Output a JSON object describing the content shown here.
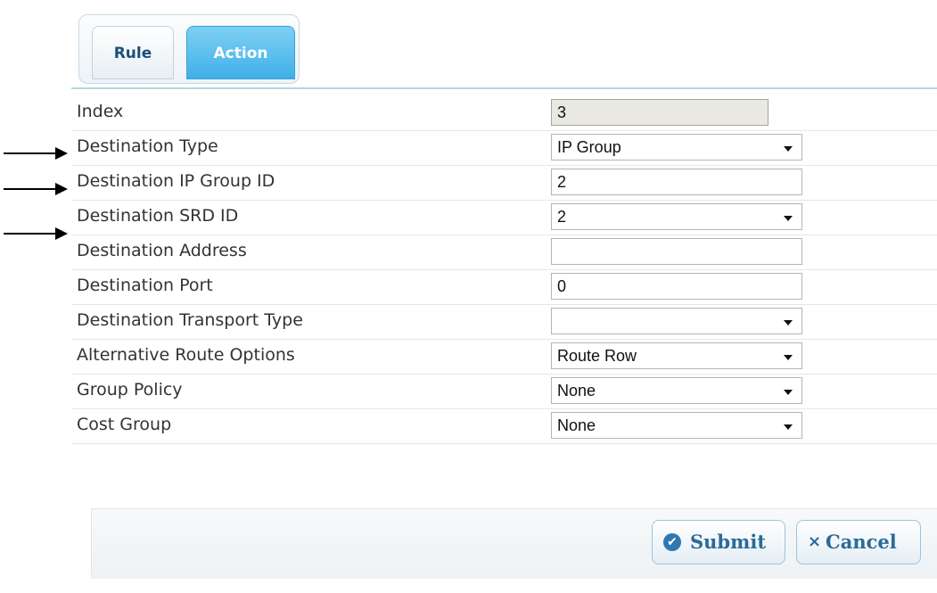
{
  "tabs": [
    {
      "label": "Rule"
    },
    {
      "label": "Action"
    }
  ],
  "form": {
    "fields": [
      {
        "label": "Index",
        "value": "3",
        "kind": "readonly"
      },
      {
        "label": "Destination Type",
        "value": "IP Group",
        "kind": "select"
      },
      {
        "label": "Destination IP Group ID",
        "value": "2",
        "kind": "text"
      },
      {
        "label": "Destination SRD ID",
        "value": "2",
        "kind": "select"
      },
      {
        "label": "Destination Address",
        "value": "",
        "kind": "text"
      },
      {
        "label": "Destination Port",
        "value": "0",
        "kind": "text"
      },
      {
        "label": "Destination Transport Type",
        "value": "",
        "kind": "select"
      },
      {
        "label": "Alternative Route Options",
        "value": "Route Row",
        "kind": "select"
      },
      {
        "label": "Group Policy",
        "value": "None",
        "kind": "select"
      },
      {
        "label": "Cost Group",
        "value": "None",
        "kind": "select"
      }
    ]
  },
  "buttons": {
    "submit_label": "Submit",
    "cancel_label": "Cancel"
  },
  "icons": {
    "submit": "check-circle-icon",
    "cancel": "x-icon"
  },
  "colors": {
    "accent": "#3fb0e8",
    "button_text": "#2b6a98"
  }
}
